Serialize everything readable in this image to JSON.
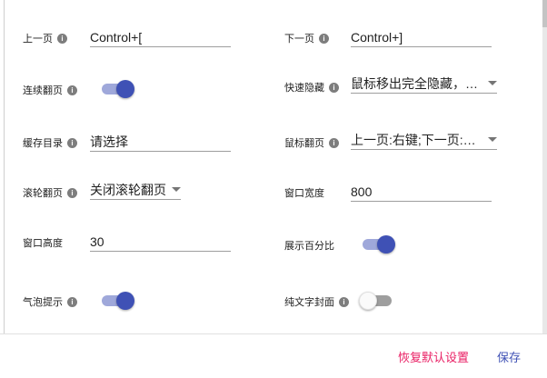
{
  "colors": {
    "accent": "#3f51b5",
    "accent_light": "#9fa8da",
    "reset": "#e91e63",
    "save": "#3f51b5"
  },
  "settings": {
    "prev_page": {
      "label": "上一页",
      "value": "Control+["
    },
    "next_page": {
      "label": "下一页",
      "value": "Control+]"
    },
    "continuous_flip": {
      "label": "连续翻页",
      "on": true
    },
    "quick_hide": {
      "label": "快速隐藏",
      "value": "鼠标移出完全隐藏，鼠..."
    },
    "cache_dir": {
      "label": "缓存目录",
      "value": "请选择"
    },
    "mouse_flip": {
      "label": "鼠标翻页",
      "value": "上一页:右键;下一页:左..."
    },
    "wheel_flip": {
      "label": "滚轮翻页",
      "value": "关闭滚轮翻页"
    },
    "window_width": {
      "label": "窗口宽度",
      "value": "800"
    },
    "window_height": {
      "label": "窗口高度",
      "value": "30"
    },
    "show_percent": {
      "label": "展示百分比",
      "on": true
    },
    "bubble_tip": {
      "label": "气泡提示",
      "on": true
    },
    "text_cover": {
      "label": "纯文字封面",
      "on": false
    }
  },
  "footer": {
    "reset_label": "恢复默认设置",
    "save_label": "保存"
  }
}
